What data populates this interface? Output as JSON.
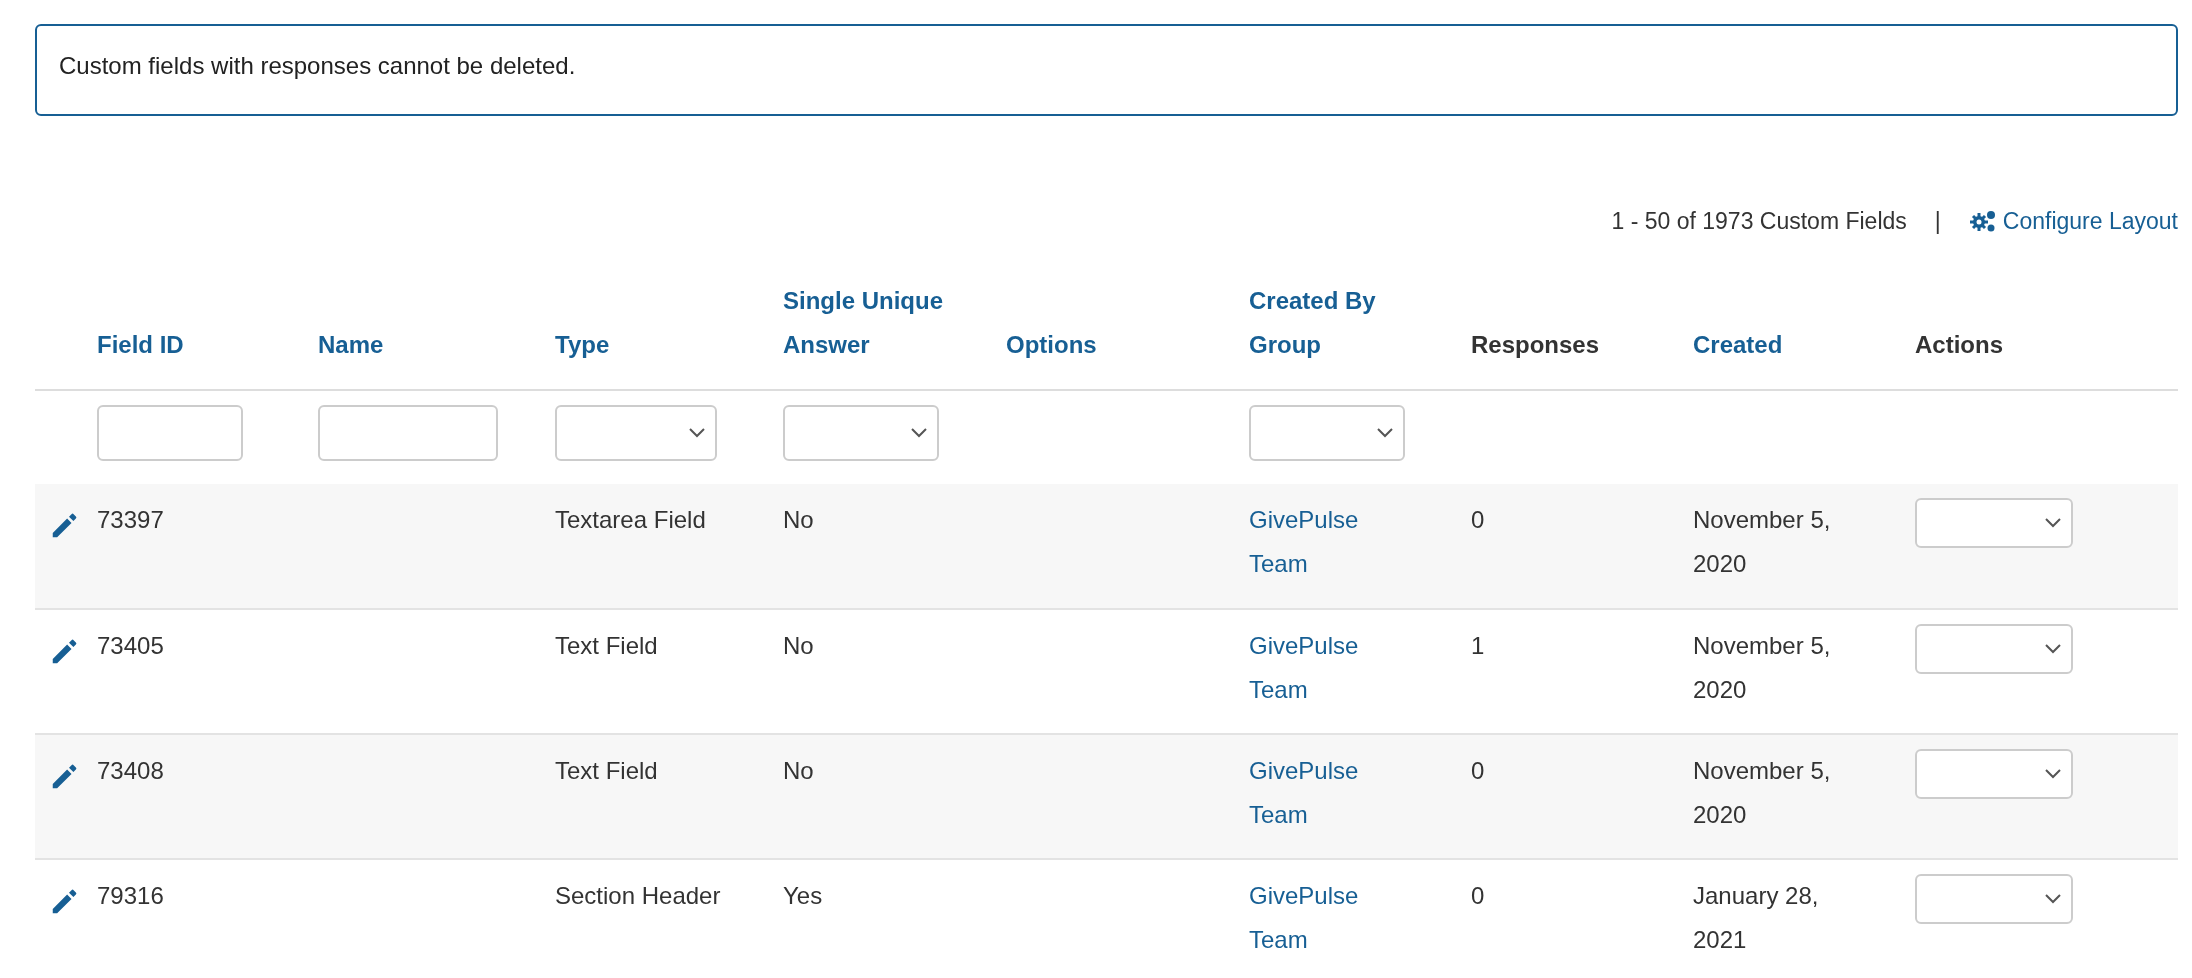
{
  "notice": {
    "text": "Custom fields with responses cannot be deleted."
  },
  "pager": {
    "summary": "1 - 50 of 1973 Custom Fields",
    "separator": "|",
    "configure_link": "Configure Layout"
  },
  "table": {
    "columns": [
      {
        "label": "Field ID",
        "sortable": true,
        "kind": "text"
      },
      {
        "label": "Name",
        "sortable": true,
        "kind": "text"
      },
      {
        "label": "Type",
        "sortable": true,
        "kind": "select"
      },
      {
        "label": "Single Unique Answer",
        "sortable": true,
        "kind": "select"
      },
      {
        "label": "Options",
        "sortable": true,
        "kind": "plain"
      },
      {
        "label": "Created By Group",
        "sortable": true,
        "kind": "select"
      },
      {
        "label": "Responses",
        "sortable": false,
        "kind": "plain"
      },
      {
        "label": "Created",
        "sortable": true,
        "kind": "plain"
      },
      {
        "label": "Actions",
        "sortable": false,
        "kind": "plain"
      }
    ],
    "rows": [
      {
        "field_id": "73397",
        "type": "Textarea Field",
        "single_unique_answer": "No",
        "created_by_group": "GivePulse Team",
        "responses": "0",
        "created": "November 5, 2020"
      },
      {
        "field_id": "73405",
        "type": "Text Field",
        "single_unique_answer": "No",
        "created_by_group": "GivePulse Team",
        "responses": "1",
        "created": "November 5, 2020"
      },
      {
        "field_id": "73408",
        "type": "Text Field",
        "single_unique_answer": "No",
        "created_by_group": "GivePulse Team",
        "responses": "0",
        "created": "November 5, 2020"
      },
      {
        "field_id": "79316",
        "type": "Section Header",
        "single_unique_answer": "Yes",
        "created_by_group": "GivePulse Team",
        "responses": "0",
        "created": "January 28, 2021"
      }
    ]
  }
}
